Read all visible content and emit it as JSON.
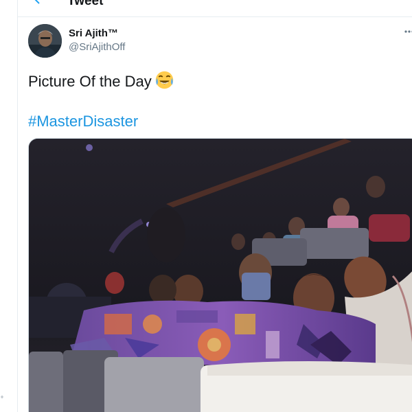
{
  "header": {
    "title": "Tweet"
  },
  "tweet": {
    "author_name": "Sri Ajith™",
    "author_handle": "@SriAjithOff",
    "text": "Picture Of the Day",
    "hashtag": "#MasterDisaster"
  },
  "icons": {
    "back": "back-arrow-icon",
    "more": "more-options-icon",
    "emoji": "face-with-tears-of-joy-emoji"
  },
  "colors": {
    "accent": "#1b95e0",
    "text_primary": "#14171a",
    "text_secondary": "#657786",
    "border": "#e6ecf0"
  }
}
